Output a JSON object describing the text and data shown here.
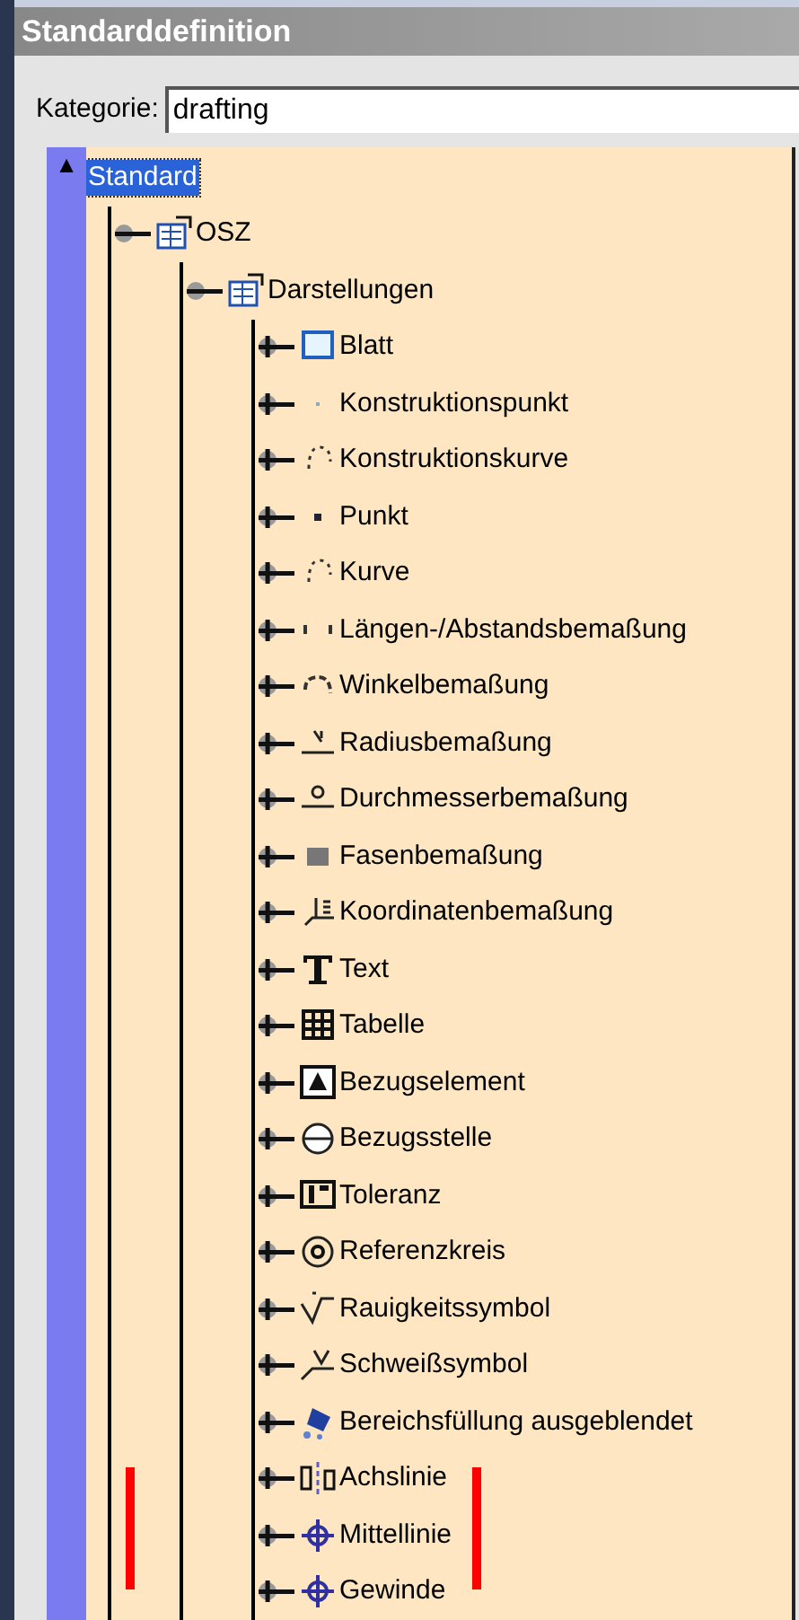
{
  "window": {
    "title": "Standarddefinition"
  },
  "category": {
    "label": "Kategorie:",
    "value": "drafting"
  },
  "tree": {
    "toggle": "▲",
    "items": [
      {
        "label": "Standard",
        "selected": true,
        "expanded": true,
        "children": [
          {
            "label": "OSZ",
            "selected": false,
            "expanded": true,
            "children": [
              {
                "label": "Darstellungen",
                "selected": false,
                "expanded": true,
                "children": [
                  {
                    "label": "Blatt",
                    "selected": false,
                    "expanded": false
                  },
                  {
                    "label": "Konstruktionspunkt",
                    "selected": false,
                    "expanded": false
                  },
                  {
                    "label": "Konstruktionskurve",
                    "selected": false,
                    "expanded": false
                  },
                  {
                    "label": "Punkt",
                    "selected": false,
                    "expanded": false
                  },
                  {
                    "label": "Kurve",
                    "selected": false,
                    "expanded": false
                  },
                  {
                    "label": "Längen-/Abstandsbemaßung",
                    "selected": false,
                    "expanded": false
                  },
                  {
                    "label": "Winkelbemaßung",
                    "selected": false,
                    "expanded": false
                  },
                  {
                    "label": "Radiusbemaßung",
                    "selected": false,
                    "expanded": false
                  },
                  {
                    "label": "Durchmesserbemaßung",
                    "selected": false,
                    "expanded": false
                  },
                  {
                    "label": "Fasenbemaßung",
                    "selected": false,
                    "expanded": false
                  },
                  {
                    "label": "Koordinatenbemaßung",
                    "selected": false,
                    "expanded": false
                  },
                  {
                    "label": "Text",
                    "selected": false,
                    "expanded": false
                  },
                  {
                    "label": "Tabelle",
                    "selected": false,
                    "expanded": false
                  },
                  {
                    "label": "Bezugselement",
                    "selected": false,
                    "expanded": false
                  },
                  {
                    "label": "Bezugsstelle",
                    "selected": false,
                    "expanded": false
                  },
                  {
                    "label": "Toleranz",
                    "selected": false,
                    "expanded": false
                  },
                  {
                    "label": "Referenzkreis",
                    "selected": false,
                    "expanded": false
                  },
                  {
                    "label": "Rauigkeitssymbol",
                    "selected": false,
                    "expanded": false
                  },
                  {
                    "label": "Schweißsymbol",
                    "selected": false,
                    "expanded": false
                  },
                  {
                    "label": "Bereichsfüllung ausgeblendet",
                    "selected": false,
                    "expanded": false
                  },
                  {
                    "label": "Achslinie",
                    "selected": false,
                    "expanded": false
                  },
                  {
                    "label": "Mittellinie",
                    "selected": false,
                    "expanded": false
                  },
                  {
                    "label": "Gewinde",
                    "selected": false,
                    "expanded": false
                  }
                ]
              }
            ]
          }
        ]
      }
    ]
  }
}
